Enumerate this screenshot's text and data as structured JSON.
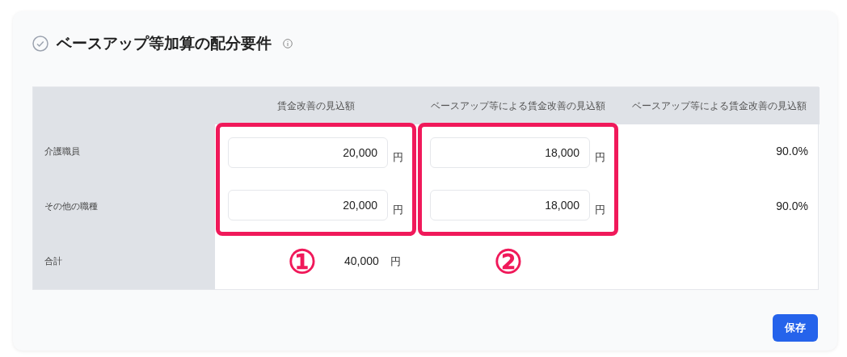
{
  "section": {
    "title": "ベースアップ等加算の配分要件"
  },
  "table": {
    "columns": [
      "賃金改善の見込額",
      "ベースアップ等による賃金改善の見込額",
      "ベースアップ等による賃金改善の見込額"
    ],
    "rows": [
      {
        "label": "介護職員",
        "wage": "20,000",
        "wage_unit": "円",
        "base_up": "18,000",
        "base_up_unit": "円",
        "ratio": "90.0%"
      },
      {
        "label": "その他の職種",
        "wage": "20,000",
        "wage_unit": "円",
        "base_up": "18,000",
        "base_up_unit": "円",
        "ratio": "90.0%"
      }
    ],
    "total": {
      "label": "合計",
      "value": "40,000",
      "unit": "円"
    }
  },
  "annotations": [
    "①",
    "②"
  ],
  "save_button": "保存"
}
